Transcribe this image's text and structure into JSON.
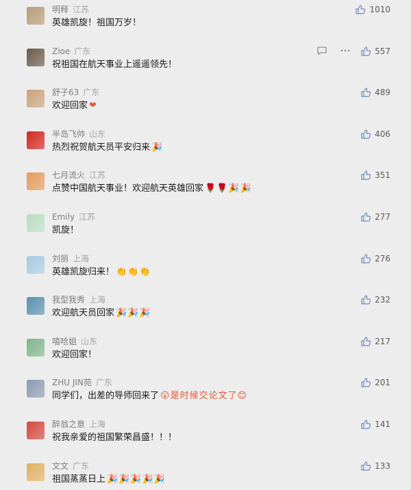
{
  "colors": {
    "background": "#ededed",
    "nickname": "#7d7d7d",
    "location": "#a3a3a3",
    "text": "#191919",
    "like_icon": "#6f89b8"
  },
  "comments": [
    {
      "nick": "明释",
      "loc": "江苏",
      "text": "英雄凯旋！祖国万岁！",
      "emojis": "",
      "likes": "1010",
      "avatar_color": "#b89a78"
    },
    {
      "nick": "Zioe",
      "loc": "广东",
      "text": "祝祖国在航天事业上遥遥领先！",
      "emojis": "",
      "likes": "557",
      "avatar_color": "#6a5a4a",
      "show_actions": true
    },
    {
      "nick": "舒子63",
      "loc": "广东",
      "text": "欢迎回家",
      "emojis": "❤",
      "likes": "489",
      "avatar_color": "#c9a27a"
    },
    {
      "nick": "半岛飞帅",
      "loc": "山东",
      "text": "热烈祝贺航天员平安归来",
      "emojis": "🎉",
      "likes": "406",
      "avatar_color": "#d0261e"
    },
    {
      "nick": "七月流火",
      "loc": "江苏",
      "text": "点赞中国航天事业！欢迎航天英雄回家",
      "emojis": "🌹🌹🎉🎉",
      "likes": "351",
      "avatar_color": "#e39a5c"
    },
    {
      "nick": "Emily",
      "loc": "江苏",
      "text": "凯旋！",
      "emojis": "",
      "likes": "277",
      "avatar_color": "#b8dcc0"
    },
    {
      "nick": "刘丽",
      "loc": "上海",
      "text": "英雄凯旋归来！",
      "emojis": "👏👏👏",
      "likes": "276",
      "avatar_color": "#a8c8e0"
    },
    {
      "nick": "我型我秀",
      "loc": "上海",
      "text": "欢迎航天员回家",
      "emojis": "🎉🎉🎉",
      "likes": "232",
      "avatar_color": "#5a8fb0"
    },
    {
      "nick": "嘻哈姐",
      "loc": "山东",
      "text": "欢迎回家！",
      "emojis": "",
      "likes": "217",
      "avatar_color": "#7fb58a"
    },
    {
      "nick": "ZHU JIN苑",
      "loc": "广东",
      "text": "同学们，出差的导师回来了",
      "emojis": "😮是时候交论文了😊",
      "likes": "201",
      "avatar_color": "#8a9ab0"
    },
    {
      "nick": "醉翁之意",
      "loc": "上海",
      "text": "祝我亲爱的祖国繁荣昌盛！！！",
      "emojis": "",
      "likes": "141",
      "avatar_color": "#d24a3e"
    },
    {
      "nick": "文文",
      "loc": "广东",
      "text": "祖国蒸蒸日上",
      "emojis": "🎉🎉🎉🎉🎉",
      "likes": "133",
      "avatar_color": "#e0b060"
    }
  ]
}
